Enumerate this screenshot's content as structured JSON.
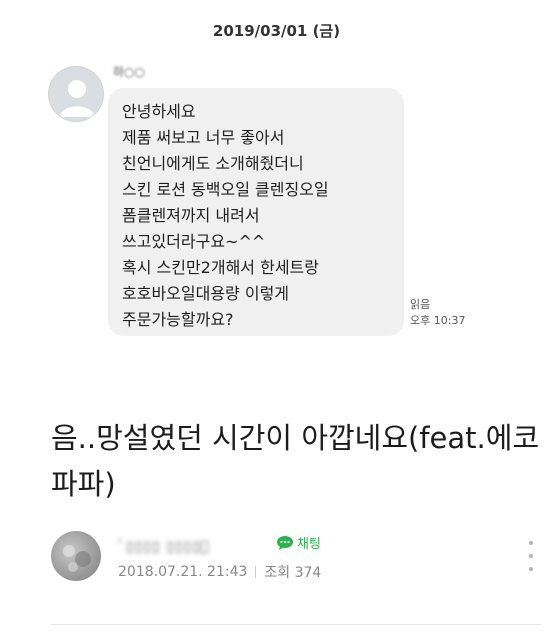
{
  "chat": {
    "date": "2019/03/01 (금)",
    "sender_name": "하○○",
    "message_lines": [
      "안녕하세요",
      "제품 써보고 너무 좋아서",
      "친언니에게도 소개해줬더니",
      "스킨 로션  동백오일 클렌징오일",
      "폼클렌져까지 내려서",
      "쓰고있더라구요~^^",
      "혹시 스킨만2개해서 한세트랑",
      "호호바오일대용량 이렇게",
      "주문가능할까요?"
    ],
    "read_label": "읽음",
    "time": "오후 10:37"
  },
  "post": {
    "title": "음..망설였던 시간이 아깝네요(feat.에코파파)",
    "author_name": "ﾟ▯▯▯▯ ▯▯▯▯ﾟ",
    "chat_label": "채팅",
    "date": "2018.07.21. 21:43",
    "views": "조회 374"
  },
  "colors": {
    "bubble_bg": "#f0f0f0",
    "chat_green": "#2bb24c",
    "meta_gray": "#888888"
  },
  "icons": {
    "avatar": "default-user-icon",
    "chat": "speech-bubble-icon",
    "more": "vertical-dots-icon"
  }
}
